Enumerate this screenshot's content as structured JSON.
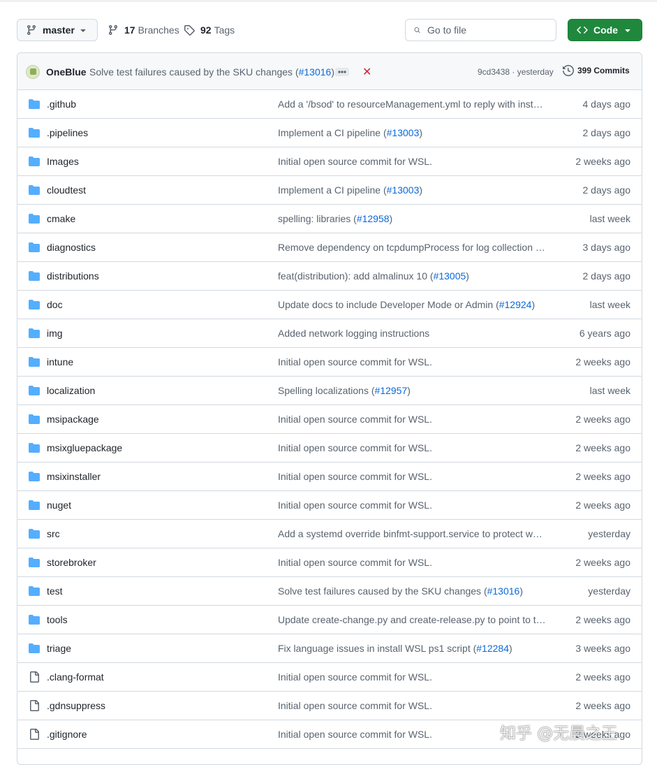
{
  "toolbar": {
    "branch": "master",
    "branches_count": "17",
    "branches_label": "Branches",
    "tags_count": "92",
    "tags_label": "Tags",
    "search_placeholder": "Go to file",
    "code_label": "Code"
  },
  "latest_commit": {
    "author": "OneBlue",
    "message": "Solve test failures caused by the SKU changes (",
    "pr": "#13016",
    "message_end": ")",
    "sha": "9cd3438",
    "time": "yesterday",
    "commits_count": "399",
    "commits_label": "Commits"
  },
  "rows": [
    {
      "type": "dir",
      "name": ".github",
      "msg": "Add a '/bsod' to resourceManagement.yml to reply with inst…",
      "pr": "",
      "msg_end": "",
      "date": "4 days ago"
    },
    {
      "type": "dir",
      "name": ".pipelines",
      "msg": "Implement a CI pipeline (",
      "pr": "#13003",
      "msg_end": ")",
      "date": "2 days ago"
    },
    {
      "type": "dir",
      "name": "Images",
      "msg": "Initial open source commit for WSL.",
      "pr": "",
      "msg_end": "",
      "date": "2 weeks ago"
    },
    {
      "type": "dir",
      "name": "cloudtest",
      "msg": "Implement a CI pipeline (",
      "pr": "#13003",
      "msg_end": ")",
      "date": "2 days ago"
    },
    {
      "type": "dir",
      "name": "cmake",
      "msg": "spelling: libraries (",
      "pr": "#12958",
      "msg_end": ")",
      "date": "last week"
    },
    {
      "type": "dir",
      "name": "diagnostics",
      "msg": "Remove dependency on tcpdumpProcess for log collection (…",
      "pr": "",
      "msg_end": "",
      "date": "3 days ago"
    },
    {
      "type": "dir",
      "name": "distributions",
      "msg": "feat(distribution): add almalinux 10 (",
      "pr": "#13005",
      "msg_end": ")",
      "date": "2 days ago"
    },
    {
      "type": "dir",
      "name": "doc",
      "msg": "Update docs to include Developer Mode or Admin (",
      "pr": "#12924",
      "msg_end": ")",
      "date": "last week"
    },
    {
      "type": "dir",
      "name": "img",
      "msg": "Added network logging instructions",
      "pr": "",
      "msg_end": "",
      "date": "6 years ago"
    },
    {
      "type": "dir",
      "name": "intune",
      "msg": "Initial open source commit for WSL.",
      "pr": "",
      "msg_end": "",
      "date": "2 weeks ago"
    },
    {
      "type": "dir",
      "name": "localization",
      "msg": "Spelling localizations (",
      "pr": "#12957",
      "msg_end": ")",
      "date": "last week"
    },
    {
      "type": "dir",
      "name": "msipackage",
      "msg": "Initial open source commit for WSL.",
      "pr": "",
      "msg_end": "",
      "date": "2 weeks ago"
    },
    {
      "type": "dir",
      "name": "msixgluepackage",
      "msg": "Initial open source commit for WSL.",
      "pr": "",
      "msg_end": "",
      "date": "2 weeks ago"
    },
    {
      "type": "dir",
      "name": "msixinstaller",
      "msg": "Initial open source commit for WSL.",
      "pr": "",
      "msg_end": "",
      "date": "2 weeks ago"
    },
    {
      "type": "dir",
      "name": "nuget",
      "msg": "Initial open source commit for WSL.",
      "pr": "",
      "msg_end": "",
      "date": "2 weeks ago"
    },
    {
      "type": "dir",
      "name": "src",
      "msg": "Add a systemd override binfmt-support.service to protect w…",
      "pr": "",
      "msg_end": "",
      "date": "yesterday"
    },
    {
      "type": "dir",
      "name": "storebroker",
      "msg": "Initial open source commit for WSL.",
      "pr": "",
      "msg_end": "",
      "date": "2 weeks ago"
    },
    {
      "type": "dir",
      "name": "test",
      "msg": "Solve test failures caused by the SKU changes (",
      "pr": "#13016",
      "msg_end": ")",
      "date": "yesterday"
    },
    {
      "type": "dir",
      "name": "tools",
      "msg": "Update create-change.py and create-release.py to point to t…",
      "pr": "",
      "msg_end": "",
      "date": "2 weeks ago"
    },
    {
      "type": "dir",
      "name": "triage",
      "msg": "Fix language issues in install WSL ps1 script (",
      "pr": "#12284",
      "msg_end": ")",
      "date": "3 weeks ago"
    },
    {
      "type": "file",
      "name": ".clang-format",
      "msg": "Initial open source commit for WSL.",
      "pr": "",
      "msg_end": "",
      "date": "2 weeks ago"
    },
    {
      "type": "file",
      "name": ".gdnsuppress",
      "msg": "Initial open source commit for WSL.",
      "pr": "",
      "msg_end": "",
      "date": "2 weeks ago"
    },
    {
      "type": "file",
      "name": ".gitignore",
      "msg": "Initial open source commit for WSL.",
      "pr": "",
      "msg_end": "",
      "date": "2 weeks ago"
    }
  ],
  "watermark": "知乎 @无晨之王",
  "colors": {
    "folder": "#54aeff",
    "link": "#0969da",
    "code_button": "#1f883d",
    "danger": "#d1242f"
  }
}
